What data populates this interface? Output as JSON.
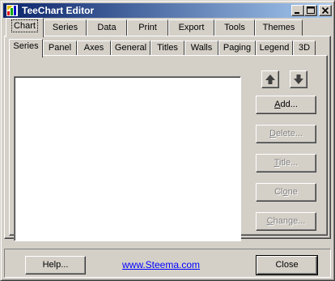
{
  "window": {
    "title": "TeeChart Editor"
  },
  "main_tabs": [
    {
      "label": "Chart",
      "active": true
    },
    {
      "label": "Series"
    },
    {
      "label": "Data"
    },
    {
      "label": "Print"
    },
    {
      "label": "Export"
    },
    {
      "label": "Tools"
    },
    {
      "label": "Themes"
    }
  ],
  "sub_tabs": [
    {
      "label": "Series",
      "active": true
    },
    {
      "label": "Panel"
    },
    {
      "label": "Axes"
    },
    {
      "label": "General"
    },
    {
      "label": "Titles"
    },
    {
      "label": "Walls"
    },
    {
      "label": "Paging"
    },
    {
      "label": "Legend"
    },
    {
      "label": "3D"
    }
  ],
  "series_panel": {
    "buttons": {
      "add": {
        "underline": "A",
        "rest": "dd..."
      },
      "delete": {
        "underline": "D",
        "rest": "elete..."
      },
      "title": {
        "underline": "T",
        "rest": "itle..."
      },
      "clone": {
        "pre": "Cl",
        "underline": "o",
        "rest": "ne"
      },
      "change": {
        "underline": "C",
        "rest": "hange..."
      }
    },
    "move_up_icon": "arrow-up",
    "move_down_icon": "arrow-down"
  },
  "footer": {
    "help_label": "Help...",
    "link_text": "www.Steema.com",
    "close_label": "Close"
  },
  "colors": {
    "titlebar_start": "#0a246a",
    "titlebar_end": "#a6caf0",
    "face": "#d4d0c8",
    "link": "#0000ff"
  }
}
